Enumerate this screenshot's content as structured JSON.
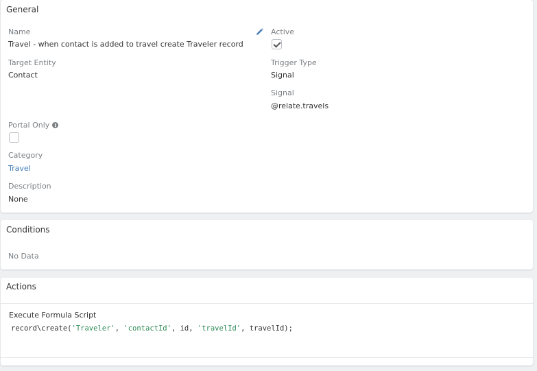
{
  "general": {
    "title": "General",
    "name_label": "Name",
    "name_value": "Travel - when contact is added to travel create Traveler record",
    "active_label": "Active",
    "active_checked": true,
    "target_entity_label": "Target Entity",
    "target_entity_value": "Contact",
    "trigger_type_label": "Trigger Type",
    "trigger_type_value": "Signal",
    "signal_label": "Signal",
    "signal_value": "@relate.travels",
    "portal_only_label": "Portal Only",
    "portal_only_checked": false,
    "category_label": "Category",
    "category_value": "Travel",
    "description_label": "Description",
    "description_value": "None",
    "icons": {
      "edit": "pencil-icon",
      "info": "info-icon"
    }
  },
  "conditions": {
    "title": "Conditions",
    "empty_text": "No Data"
  },
  "actions": {
    "title": "Actions",
    "action_type": "Execute Formula Script",
    "code": {
      "fn": "record\\create(",
      "arg1": "'Traveler'",
      "sep1": ", ",
      "arg2": "'contactId'",
      "sep2": ", id, ",
      "arg3": "'travelId'",
      "tail": ", travelId);"
    }
  },
  "colors": {
    "link": "#3f7bb6",
    "string_literal": "#2e8b57",
    "label": "#7b7f83"
  }
}
